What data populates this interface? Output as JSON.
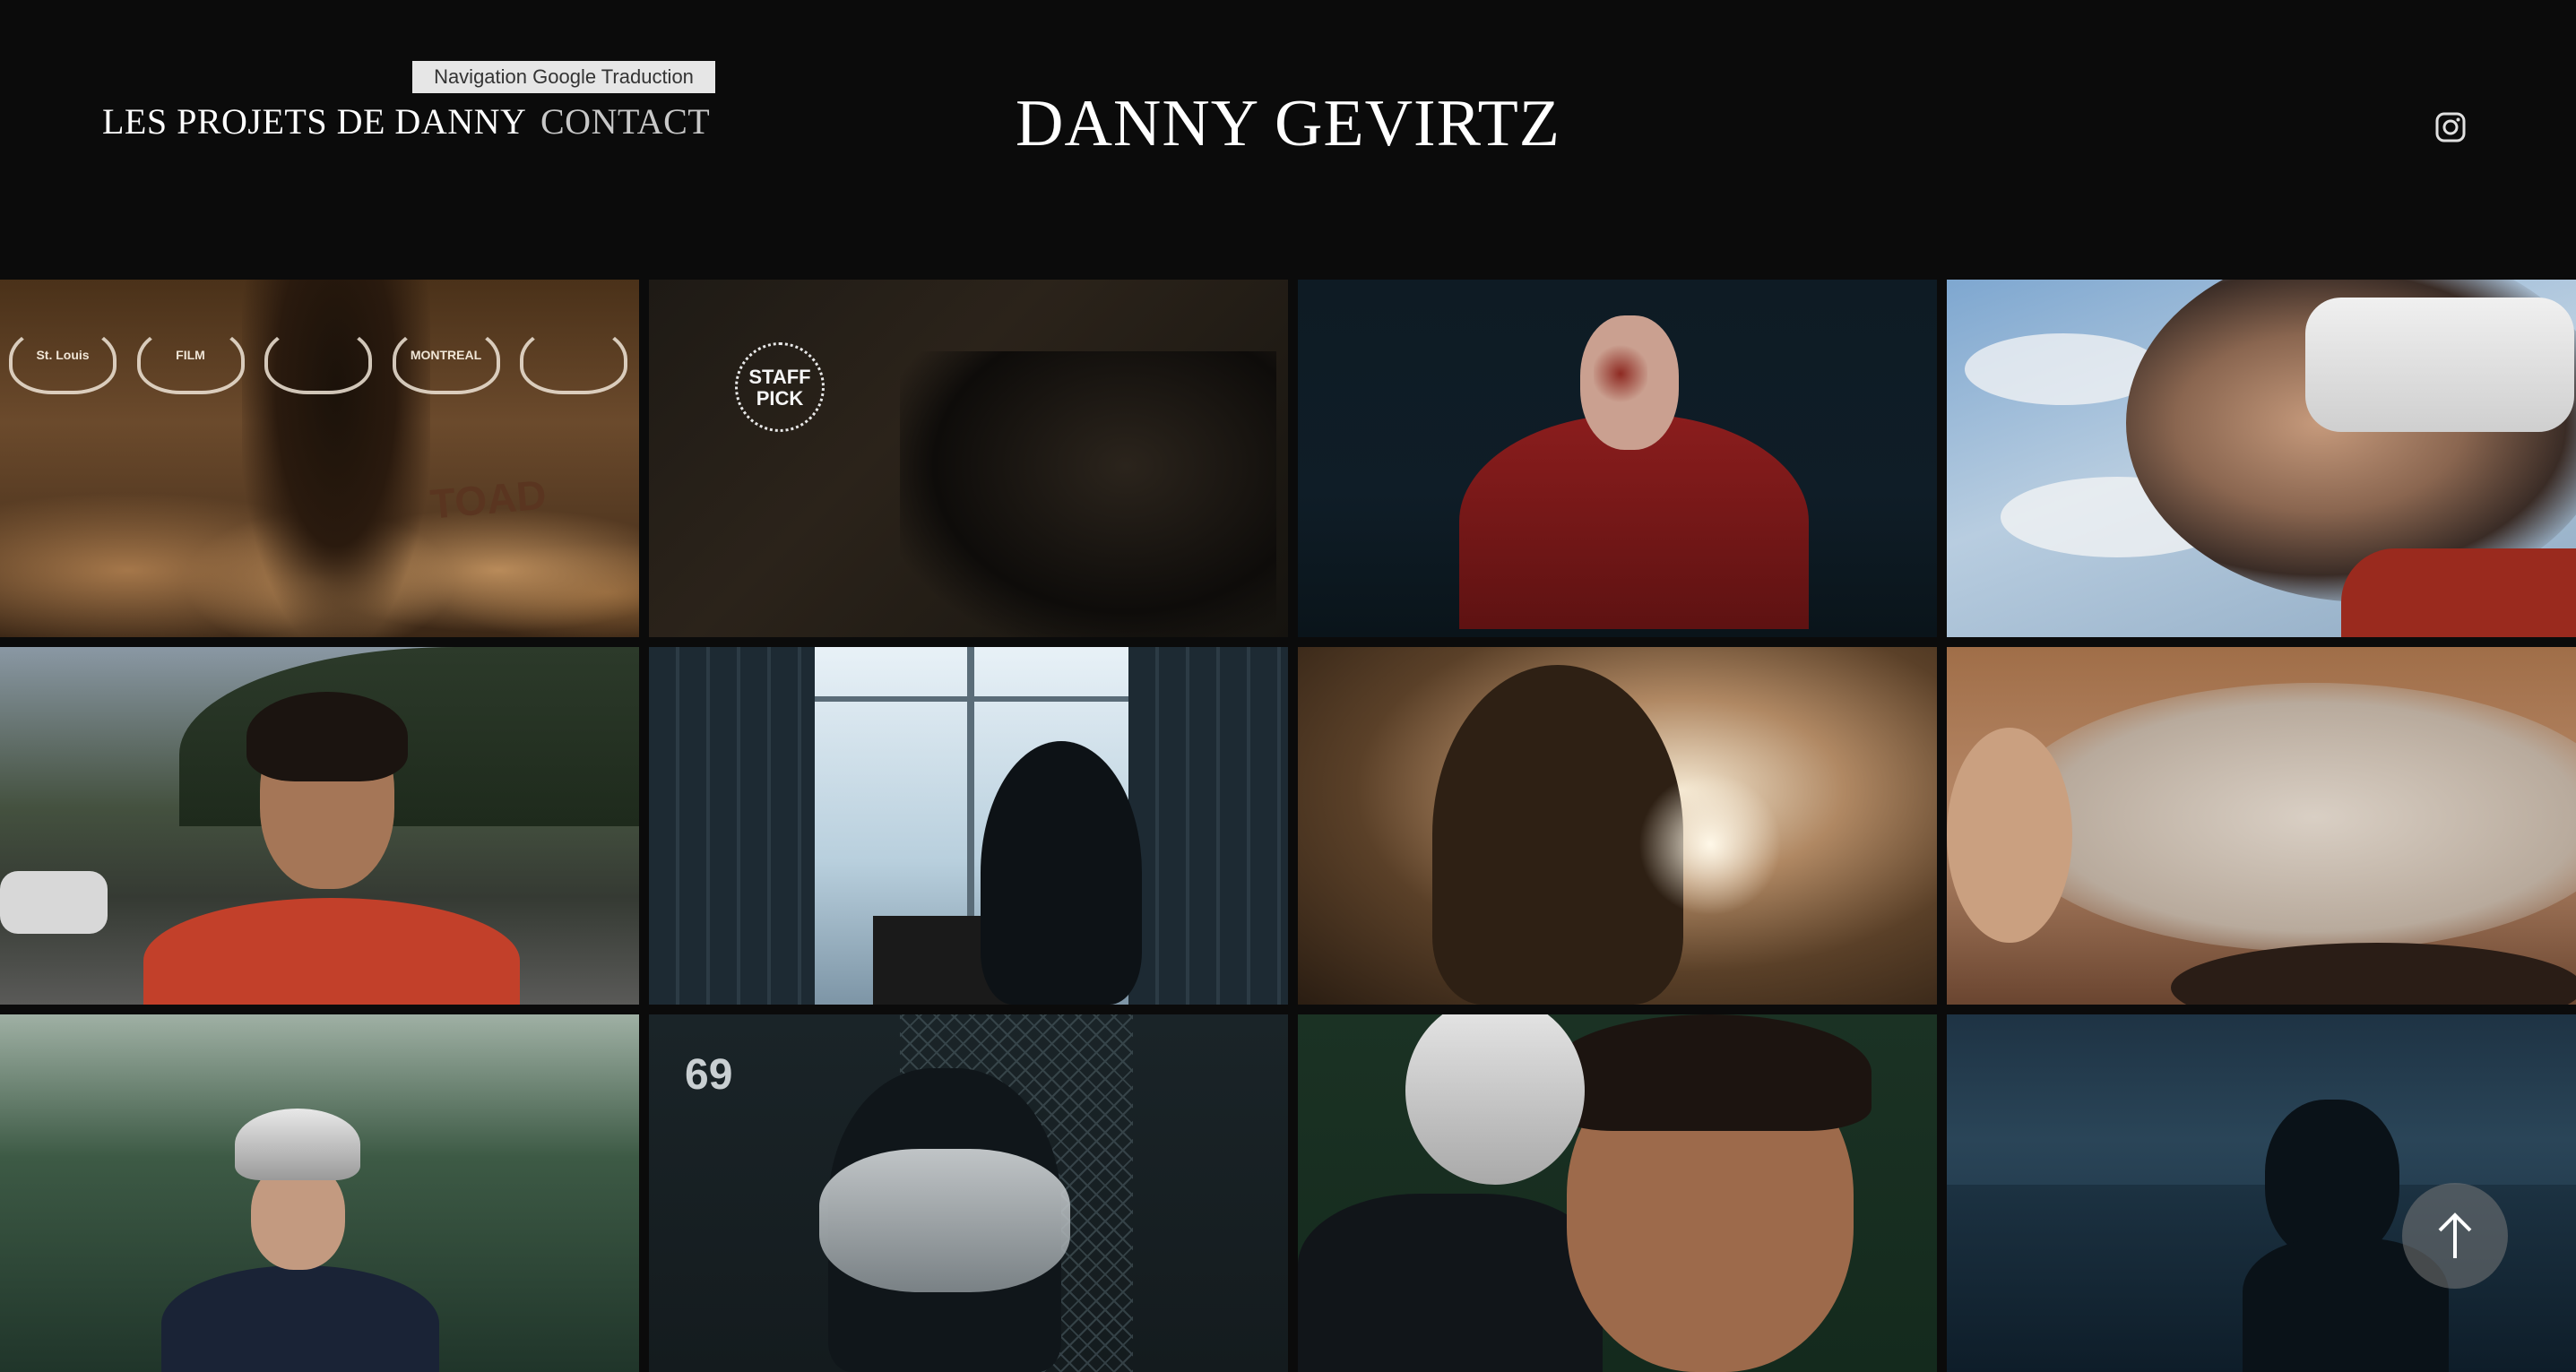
{
  "header": {
    "nav": {
      "projects_label": "LES PROJETS DE DANNY",
      "contact_label": "CONTACT"
    },
    "tooltip": "Navigation Google Traduction",
    "site_title": "DANNY GEVIRTZ",
    "social_icon": "instagram-icon"
  },
  "gallery": {
    "tile1": {
      "laurels": [
        "St. Louis",
        "FILM",
        "",
        "MONTREAL",
        ""
      ],
      "body_text": "TOAD"
    },
    "tile2": {
      "badge": "STAFF PICK"
    },
    "tile10": {
      "jersey_number": "69"
    }
  },
  "scroll_top": {
    "icon": "arrow-up-icon"
  },
  "colors": {
    "background": "#0b0b0b",
    "nav_active": "#ffffff",
    "nav_inactive": "#c8c8c8",
    "tooltip_bg": "#e6e6e6"
  }
}
